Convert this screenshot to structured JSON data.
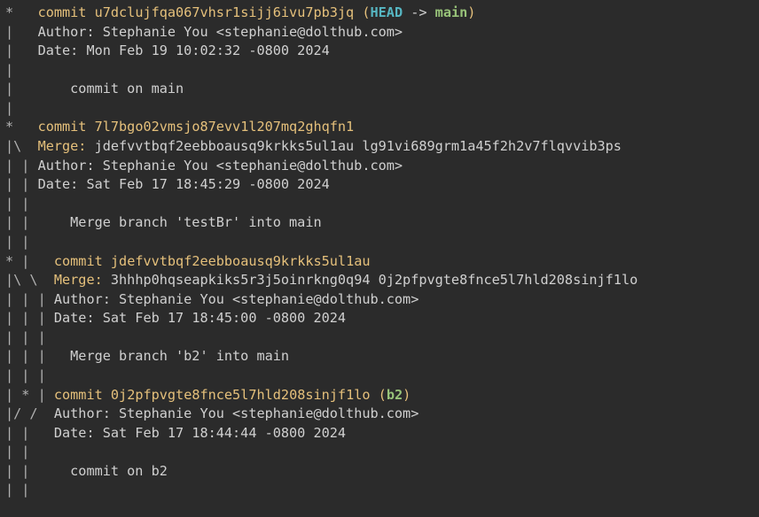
{
  "commits": [
    {
      "graph_head": "*   ",
      "kw": "commit",
      "hash": "u7dclujfqa067vhsr1sijj6ivu7pb3jq",
      "refs": {
        "head": "HEAD",
        "arrow": " -> ",
        "branch": "main"
      },
      "lines": [
        {
          "graph": "|   ",
          "text": "Author: Stephanie You <stephanie@dolthub.com>"
        },
        {
          "graph": "|   ",
          "text": "Date: Mon Feb 19 10:02:32 -0800 2024"
        },
        {
          "graph": "|   ",
          "text": ""
        },
        {
          "graph": "|       ",
          "text": "commit on main"
        },
        {
          "graph": "|   ",
          "text": ""
        }
      ]
    },
    {
      "graph_head": "*   ",
      "kw": "commit",
      "hash": "7l7bgo02vmsjo87evv1l207mq2ghqfn1",
      "lines": [
        {
          "graph": "|\\  ",
          "merge_kw": "Merge: ",
          "text": "jdefvvtbqf2eebboausq9krkks5ul1au lg91vi689grm1a45f2h2v7flqvvib3ps"
        },
        {
          "graph": "| | ",
          "text": "Author: Stephanie You <stephanie@dolthub.com>"
        },
        {
          "graph": "| | ",
          "text": "Date: Sat Feb 17 18:45:29 -0800 2024"
        },
        {
          "graph": "| | ",
          "text": ""
        },
        {
          "graph": "| |     ",
          "text": "Merge branch 'testBr' into main"
        },
        {
          "graph": "| |   ",
          "text": ""
        }
      ]
    },
    {
      "graph_head": "* |   ",
      "kw": "commit",
      "hash": "jdefvvtbqf2eebboausq9krkks5ul1au",
      "lines": [
        {
          "graph": "|\\ \\  ",
          "merge_kw": "Merge: ",
          "text": "3hhhp0hqseapkiks5r3j5oinrkng0q94 0j2pfpvgte8fnce5l7hld208sinjf1lo"
        },
        {
          "graph": "| | | ",
          "text": "Author: Stephanie You <stephanie@dolthub.com>"
        },
        {
          "graph": "| | | ",
          "text": "Date: Sat Feb 17 18:45:00 -0800 2024"
        },
        {
          "graph": "| | | ",
          "text": ""
        },
        {
          "graph": "| | |   ",
          "text": "Merge branch 'b2' into main"
        },
        {
          "graph": "| | | ",
          "text": ""
        }
      ]
    },
    {
      "graph_head": "| * | ",
      "kw": "commit",
      "hash": "0j2pfpvgte8fnce5l7hld208sinjf1lo",
      "refs": {
        "branch": "b2"
      },
      "lines": [
        {
          "graph": "|/ /  ",
          "text": "Author: Stephanie You <stephanie@dolthub.com>"
        },
        {
          "graph": "| |   ",
          "text": "Date: Sat Feb 17 18:44:44 -0800 2024"
        },
        {
          "graph": "| |   ",
          "text": ""
        },
        {
          "graph": "| |     ",
          "text": "commit on b2"
        },
        {
          "graph": "| |   ",
          "text": ""
        }
      ]
    }
  ]
}
